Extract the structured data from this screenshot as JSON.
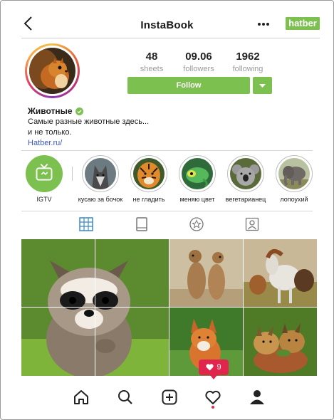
{
  "header": {
    "title": "InstaBook",
    "brand": "hatber"
  },
  "profile": {
    "name": "Животные",
    "bio_line1": "Самые разные животные здесь...",
    "bio_line2": "и не только.",
    "link": "Hatber.ru/",
    "stats": [
      {
        "value": "48",
        "label": "sheets"
      },
      {
        "value": "09.06",
        "label": "followers"
      },
      {
        "value": "1962",
        "label": "following"
      }
    ],
    "follow_label": "Follow"
  },
  "highlights": [
    {
      "label": "IGTV",
      "icon": "igtv-icon"
    },
    {
      "label": "кусаю за бочок",
      "icon": "wolf"
    },
    {
      "label": "не гладить",
      "icon": "tiger"
    },
    {
      "label": "меняю цвет",
      "icon": "chameleon"
    },
    {
      "label": "вегетарианец",
      "icon": "koala"
    },
    {
      "label": "лопоухий",
      "icon": "elephant"
    }
  ],
  "tabs": [
    "grid-icon",
    "feed-icon",
    "star-icon",
    "tagged-icon"
  ],
  "grid": {
    "posts": [
      "raccoon",
      "meerkats",
      "horses",
      "fox",
      "lynx-kittens"
    ],
    "like_count": "9"
  },
  "nav": [
    "home-icon",
    "search-icon",
    "add-icon",
    "heart-icon",
    "profile-icon"
  ],
  "colors": {
    "accent": "#7cc04f",
    "like": "#e1264d",
    "link": "#3a56b8"
  }
}
